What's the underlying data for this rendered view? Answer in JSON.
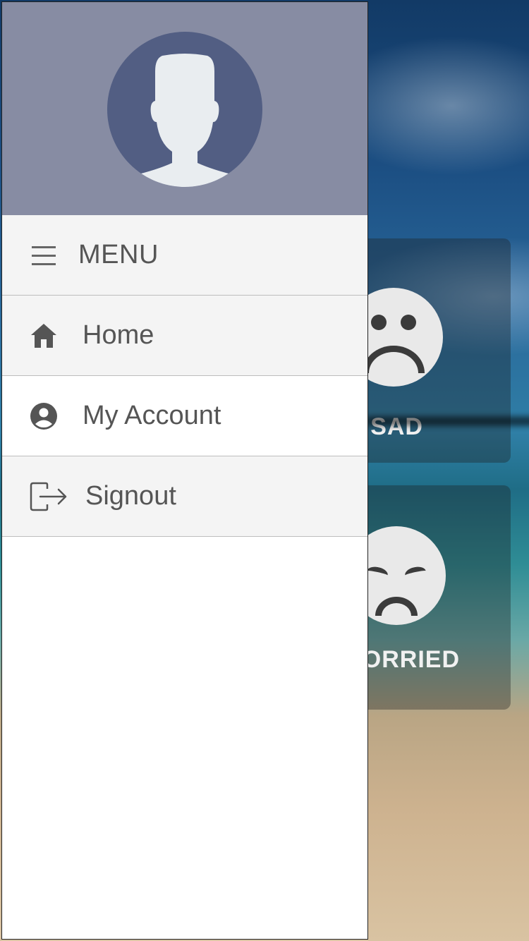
{
  "drawer": {
    "menu_title": "MENU",
    "items": [
      {
        "label": "Home",
        "icon": "home-icon"
      },
      {
        "label": "My Account",
        "icon": "account-circle-icon"
      },
      {
        "label": "Signout",
        "icon": "signout-icon"
      }
    ]
  },
  "background": {
    "moods": [
      {
        "label": "SAD",
        "icon": "sad-face-icon"
      },
      {
        "label": "ORRIED",
        "icon": "worried-face-icon"
      }
    ]
  },
  "colors": {
    "header_bg": "#878ca3",
    "avatar_bg": "#525e83",
    "text": "#555555",
    "row_alt": "#f4f4f4"
  }
}
